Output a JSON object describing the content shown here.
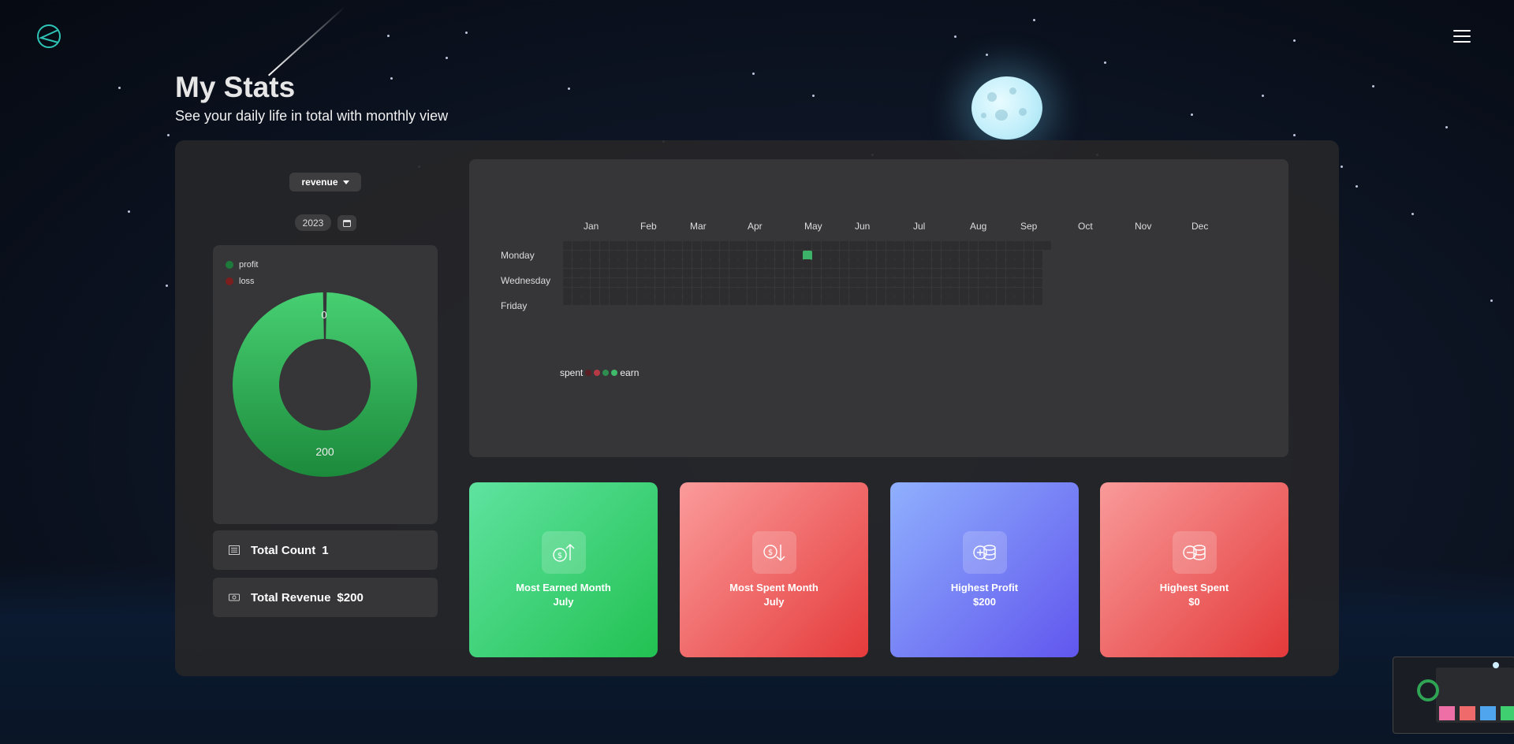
{
  "header": {
    "title": "My Stats",
    "subtitle": "See your daily life in total with monthly view"
  },
  "filters": {
    "type_value": "revenue",
    "year_value": "2023"
  },
  "donut": {
    "legend": [
      {
        "label": "profit",
        "color": "#1e7a3a"
      },
      {
        "label": "loss",
        "color": "#7a1e1e"
      }
    ],
    "slices": [
      {
        "label": "profit",
        "value": 200,
        "color": "#2ea84f"
      },
      {
        "label": "loss",
        "value": 0,
        "color": "#a83030"
      }
    ],
    "top_label": "0",
    "bottom_label": "200"
  },
  "stats": {
    "count_label": "Total Count",
    "count_value": "1",
    "revenue_label": "Total Revenue",
    "revenue_value": "$200"
  },
  "heatmap": {
    "months": [
      "Jan",
      "Feb",
      "Mar",
      "Apr",
      "May",
      "Jun",
      "Jul",
      "Aug",
      "Sep",
      "Oct",
      "Nov",
      "Dec"
    ],
    "day_labels": [
      "Monday",
      "Wednesday",
      "Friday"
    ],
    "legend_left": "spent",
    "legend_right": "earn",
    "legend_colors": [
      "#5a1f24",
      "#b53a45",
      "#2f8d50",
      "#3fb96a"
    ],
    "active_color": "#3cb368",
    "active_cells": [
      {
        "week": 26,
        "day": 1,
        "value": 200
      }
    ]
  },
  "cards": [
    {
      "title": "Most Earned Month",
      "value": "July",
      "icon": "coin-up-icon",
      "gradient": [
        "#5fe3a0",
        "#22c152"
      ]
    },
    {
      "title": "Most Spent Month",
      "value": "July",
      "icon": "coin-down-icon",
      "gradient": [
        "#fb9b9b",
        "#e53b3b"
      ]
    },
    {
      "title": "Highest Profit",
      "value": "$200",
      "icon": "coin-plus-icon",
      "gradient": [
        "#8fb0fd",
        "#6156ee"
      ]
    },
    {
      "title": "Highest Spent",
      "value": "$0",
      "icon": "coin-minus-icon",
      "gradient": [
        "#f99a9a",
        "#e43a3a"
      ]
    }
  ]
}
